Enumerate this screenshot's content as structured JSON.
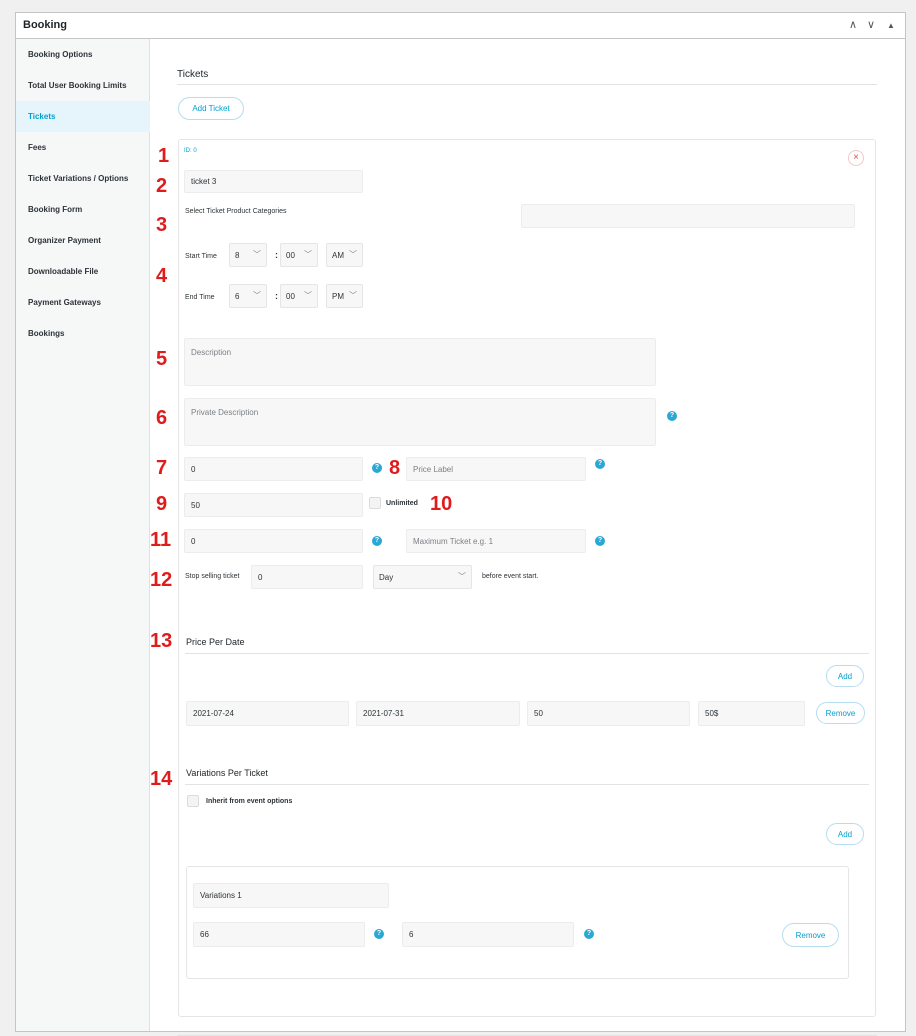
{
  "panel": {
    "title": "Booking",
    "controls": [
      "∧",
      "∨",
      "▲"
    ]
  },
  "sidebar": {
    "items": [
      {
        "label": "Booking Options"
      },
      {
        "label": "Total User Booking Limits"
      },
      {
        "label": "Tickets",
        "active": true
      },
      {
        "label": "Fees"
      },
      {
        "label": "Ticket Variations / Options"
      },
      {
        "label": "Booking Form"
      },
      {
        "label": "Organizer Payment"
      },
      {
        "label": "Downloadable File"
      },
      {
        "label": "Payment Gateways"
      },
      {
        "label": "Bookings"
      }
    ]
  },
  "tickets": {
    "section_title": "Tickets",
    "add_ticket_label": "Add Ticket",
    "id_label": "ID: 0",
    "close_icon": "×",
    "name_value": "ticket 3",
    "categories_label": "Select Ticket Product Categories",
    "start_time": {
      "label": "Start Time",
      "hour": "8",
      "minute": "00",
      "ampm": "AM"
    },
    "end_time": {
      "label": "End Time",
      "hour": "6",
      "minute": "00",
      "ampm": "PM"
    },
    "time_colon": ":",
    "description_placeholder": "Description",
    "private_description_placeholder": "Private Description",
    "price_value": "0",
    "price_label_placeholder": "Price Label",
    "capacity_value": "50",
    "unlimited_label": "Unlimited",
    "min_ticket_value": "0",
    "max_ticket_placeholder": "Maximum Ticket e.g. 1",
    "stop_selling_label": "Stop selling ticket",
    "stop_selling_value": "0",
    "stop_selling_unit": "Day",
    "stop_selling_suffix": "before event start.",
    "help_icon": "?"
  },
  "price_per_date": {
    "title": "Price Per Date",
    "add_label": "Add",
    "remove_label": "Remove",
    "row": {
      "start": "2021-07-24",
      "end": "2021-07-31",
      "price": "50",
      "label": "50$"
    }
  },
  "variations": {
    "title": "Variations Per Ticket",
    "inherit_label": "Inherit from event options",
    "add_label": "Add",
    "remove_label": "Remove",
    "item": {
      "name": "Variations 1",
      "price": "66",
      "max": "6"
    }
  },
  "markers": [
    "1",
    "2",
    "3",
    "4",
    "5",
    "6",
    "7",
    "8",
    "9",
    "10",
    "11",
    "12",
    "13",
    "14"
  ],
  "colors": {
    "accent": "#00a0d2",
    "marker": "#e01b1b",
    "help": "#2aa7d4",
    "active_bg": "#e6f5fb"
  }
}
